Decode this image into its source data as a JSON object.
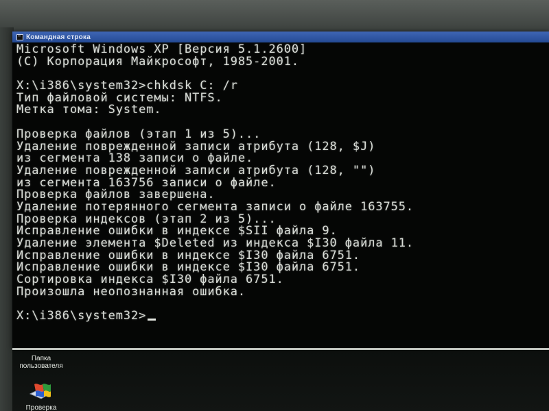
{
  "window": {
    "title": "Командная строка"
  },
  "console": {
    "lines": [
      "Microsoft Windows XP [Версия 5.1.2600]",
      "(С) Корпорация Майкрософт, 1985-2001.",
      "",
      "X:\\i386\\system32>chkdsk C: /r",
      "Тип файловой системы: NTFS.",
      "Метка тома: System.",
      "",
      "Проверка файлов (этап 1 из 5)...",
      "Удаление поврежденной записи атрибута (128, $J)",
      "из сегмента 138 записи о файле.",
      "Удаление поврежденной записи атрибута (128, \"\")",
      "из сегмента 163756 записи о файле.",
      "Проверка файлов завершена.",
      "Удаление потерянного сегмента записи о файле 163755.",
      "Проверка индексов (этап 2 из 5)...",
      "Исправление ошибки в индексе $SII файла 9.",
      "Удаление элемента $Deleted из индекса $I30 файла 11.",
      "Исправление ошибки в индексе $I30 файла 6751.",
      "Исправление ошибки в индексе $I30 файла 6751.",
      "Сортировка индекса $I30 файла 6751.",
      "Произошла неопознанная ошибка.",
      ""
    ],
    "prompt": "X:\\i386\\system32>"
  },
  "desktop": {
    "icons": [
      {
        "label": "Папка\nпользователя",
        "icon": "folder-icon"
      },
      {
        "label": "Проверка",
        "icon": "disk-check-icon"
      }
    ]
  }
}
